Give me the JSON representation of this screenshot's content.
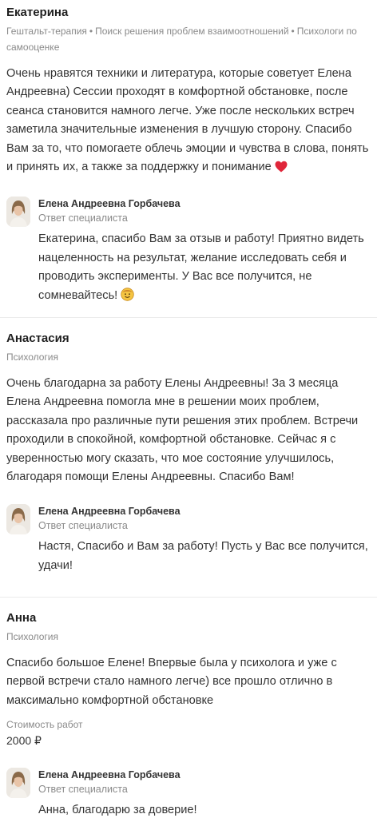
{
  "reviews": [
    {
      "author": "Екатерина",
      "tags": [
        "Гештальт-терапия",
        "Поиск решения проблем взаимоотношений",
        "Психологи по самооценке"
      ],
      "text": "Очень нравятся техники и литература, которые советует Елена Андреевна) Сессии проходят в комфортной обстановке, после сеанса становится намного легче. Уже после нескольких встреч заметила значительные изменения в лучшую сторону. Спасибо Вам за то, что помогаете облечь эмоции и чувства в слова, понять и принять их, а также за поддержку и понимание",
      "reply": {
        "name": "Елена Андреевна Горбачева",
        "role": "Ответ специалиста",
        "text": "Екатерина, спасибо Вам за отзыв и работу! Приятно видеть нацеленность на результат, желание исследовать себя и проводить эксперименты. У Вас все получится, не сомневайтесь!"
      }
    },
    {
      "author": "Анастасия",
      "tags": [
        "Психология"
      ],
      "text": "Очень благодарна за работу Елены Андреевны! За 3 месяца Елена Андреевна помогла мне в решении моих проблем, рассказала про различные пути решения этих проблем. Встречи проходили в спокойной, комфортной обстановке. Сейчас я с уверенностью могу сказать, что мое состояние улучшилось, благодаря помощи Елены Андреевны. Спасибо Вам!",
      "reply": {
        "name": "Елена Андреевна Горбачева",
        "role": "Ответ специалиста",
        "text": "Настя, Спасибо и Вам за работу! Пусть у Вас все получится, удачи!"
      }
    },
    {
      "author": "Анна",
      "tags": [
        "Психология"
      ],
      "text": "Спасибо большое Елене! Впервые была у психолога и уже с первой встречи стало намного легче) все прошло отлично в максимально комфортной обстановке",
      "price_label": "Стоимость работ",
      "price_value": "2000 ₽",
      "reply": {
        "name": "Елена Андреевна Горбачева",
        "role": "Ответ специалиста",
        "text": "Анна, благодарю за доверие!"
      }
    }
  ],
  "icons": {
    "heart": "heart-icon",
    "smile": "smiling-face-icon",
    "avatar": "specialist-avatar"
  },
  "colors": {
    "heart": "#e0263a",
    "smile": "#f5c542",
    "muted_text": "#8a8a8a",
    "divider": "#ebebeb"
  }
}
